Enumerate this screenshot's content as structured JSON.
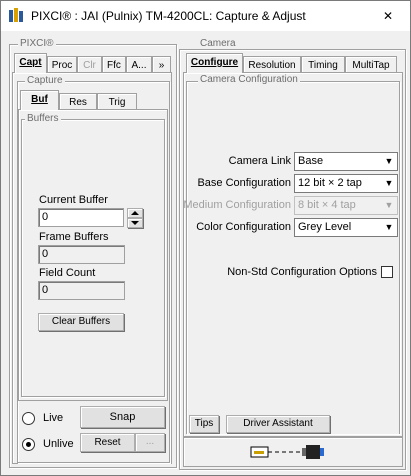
{
  "window": {
    "title": "PIXCI® : JAI (Pulnix) TM-4200CL: Capture & Adjust"
  },
  "pixci": {
    "label": "PIXCI®",
    "tabs": [
      "Capt",
      "Proc",
      "Clr",
      "Ffc",
      "A...",
      "»"
    ],
    "capture": {
      "label": "Capture",
      "tabs": [
        "Buf",
        "Res",
        "Trig"
      ],
      "buffers": {
        "label": "Buffers",
        "current_buffer_label": "Current Buffer",
        "current_buffer_value": "0",
        "frame_buffers_label": "Frame Buffers",
        "frame_buffers_value": "0",
        "field_count_label": "Field Count",
        "field_count_value": "0",
        "clear_buffers": "Clear Buffers"
      },
      "live": "Live",
      "unlive": "Unlive",
      "snap": "Snap",
      "reset": "Reset",
      "small_button": "..."
    }
  },
  "camera": {
    "label": "Camera",
    "tabs": [
      "Configure",
      "Resolution",
      "Timing",
      "MultiTap"
    ],
    "config_label": "Camera Configuration",
    "rows": [
      {
        "label": "Camera Link",
        "value": "Base"
      },
      {
        "label": "Base Configuration",
        "value": "12 bit × 2 tap"
      },
      {
        "label": "Medium Configuration",
        "value": "8 bit × 4 tap"
      },
      {
        "label": "Color Configuration",
        "value": "Grey Level"
      }
    ],
    "nonstd_label": "Non-Std Configuration Options",
    "tips": "Tips",
    "driver_assistant": "Driver Assistant"
  }
}
